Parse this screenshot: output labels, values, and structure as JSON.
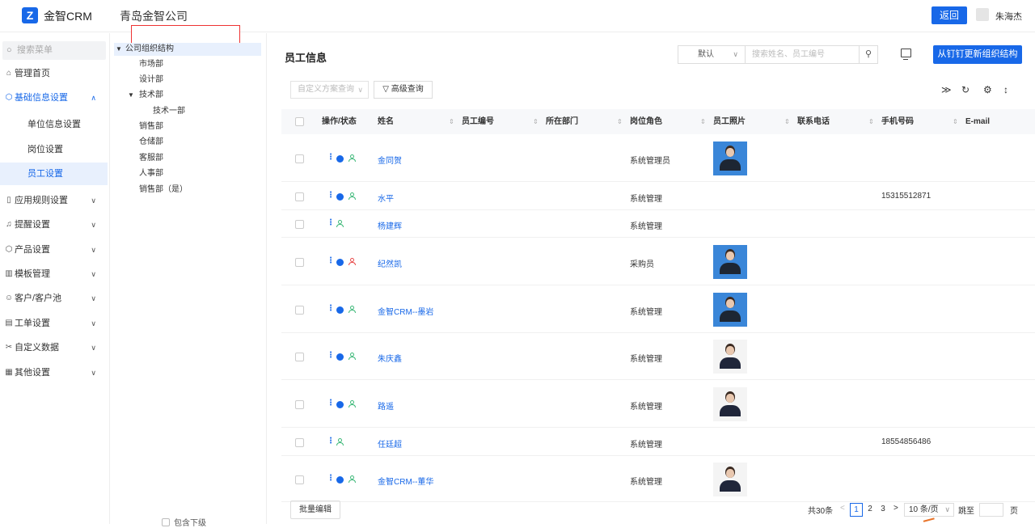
{
  "header": {
    "logo_glyph": "Z",
    "brand": "金智CRM",
    "company": "青岛金智公司",
    "back_label": "返回",
    "username": "朱海杰"
  },
  "sidebar": {
    "search_placeholder": "搜索菜单",
    "items": [
      {
        "label": "管理首页",
        "icon": "home-icon"
      },
      {
        "label": "基础信息设置",
        "icon": "cube-icon",
        "expanded": true
      },
      {
        "label": "单位信息设置"
      },
      {
        "label": "岗位设置"
      },
      {
        "label": "员工设置",
        "selected": true
      },
      {
        "label": "应用规则设置",
        "icon": "file-icon"
      },
      {
        "label": "提醒设置",
        "icon": "bell-icon"
      },
      {
        "label": "产品设置",
        "icon": "box-icon"
      },
      {
        "label": "模板管理",
        "icon": "template-icon"
      },
      {
        "label": "客户/客户池",
        "icon": "customer-icon"
      },
      {
        "label": "工单设置",
        "icon": "ticket-icon"
      },
      {
        "label": "自定义数据",
        "icon": "custom-data-icon"
      },
      {
        "label": "其他设置",
        "icon": "grid-icon"
      }
    ]
  },
  "tree": {
    "root": "公司组织结构",
    "nodes": [
      "市场部",
      "设计部",
      "技术部",
      "技术一部",
      "销售部",
      "仓储部",
      "客服部",
      "人事部",
      "销售部（是）"
    ],
    "include_sub": "包含下级"
  },
  "main": {
    "title": "员工信息",
    "default_select": "默认",
    "search_placeholder": "搜索姓名、员工编号",
    "sync_button": "从钉钉更新组织结构",
    "scheme_placeholder": "自定义方案查询",
    "advanced_query": "高级查询",
    "batch_edit": "批量编辑"
  },
  "table": {
    "columns": [
      "操作/状态",
      "姓名",
      "员工编号",
      "所在部门",
      "岗位角色",
      "员工照片",
      "联系电话",
      "手机号码",
      "E-mail"
    ],
    "rows": [
      {
        "name": "金同贺",
        "role": "系统管理员",
        "mobile": "",
        "has_dot": true,
        "status": "active",
        "photo": "blue-bg"
      },
      {
        "name": "水平",
        "role": "系统管理",
        "mobile": "15315512871",
        "has_dot": true,
        "status": "active",
        "photo": ""
      },
      {
        "name": "杨建辉",
        "role": "系统管理",
        "mobile": "",
        "has_dot": false,
        "status": "active",
        "photo": ""
      },
      {
        "name": "纪然凯",
        "role": "采购员",
        "mobile": "",
        "has_dot": true,
        "status": "disabled",
        "photo": "blue-bg"
      },
      {
        "name": "金智CRM--墨岩",
        "role": "系统管理",
        "mobile": "",
        "has_dot": true,
        "status": "active",
        "photo": "blue-bg"
      },
      {
        "name": "朱庆鑫",
        "role": "系统管理",
        "mobile": "",
        "has_dot": true,
        "status": "active",
        "photo": "white-bg"
      },
      {
        "name": "路遥",
        "role": "系统管理",
        "mobile": "",
        "has_dot": true,
        "status": "active",
        "photo": "white-bg"
      },
      {
        "name": "任廷超",
        "role": "系统管理",
        "mobile": "18554856486",
        "has_dot": false,
        "status": "active",
        "photo": ""
      },
      {
        "name": "金智CRM--董华",
        "role": "系统管理",
        "mobile": "",
        "has_dot": true,
        "status": "active",
        "photo": "white-bg"
      }
    ]
  },
  "pagination": {
    "total": "共30条",
    "pages": [
      "1",
      "2",
      "3"
    ],
    "prev": "<",
    "next": ">",
    "page_size": "10 条/页",
    "goto_label": "跳至",
    "page_unit": "页"
  },
  "colors": {
    "accent": "#1868e8",
    "disabled_user": "#e84a4a",
    "active_user": "#3cb878"
  }
}
